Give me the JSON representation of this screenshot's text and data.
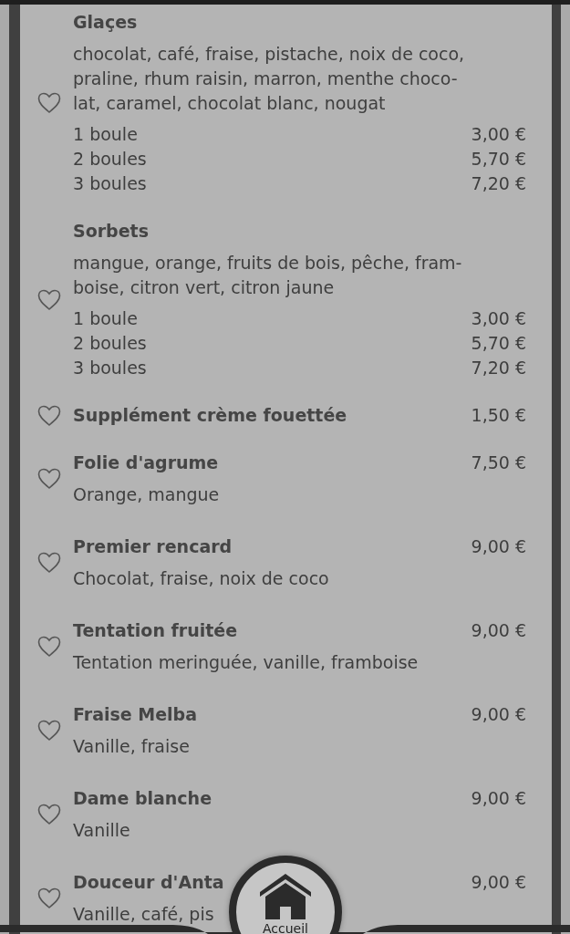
{
  "menu": [
    {
      "kind": "group",
      "name": "Glaçes",
      "description": [
        "chocolat, café, fraise, pistache, noix de coco,",
        "praline, rhum raisin, marron, menthe choco-",
        "lat, caramel, chocolat blanc, nougat"
      ],
      "prices": [
        {
          "label": "1 boule",
          "price": "3,00 €"
        },
        {
          "label": "2 boules",
          "price": "5,70 €"
        },
        {
          "label": "3 boules",
          "price": "7,20 €"
        }
      ]
    },
    {
      "kind": "group",
      "name": "Sorbets",
      "description": [
        "mangue, orange, fruits de bois, pêche, fram-",
        "boise, citron vert, citron jaune"
      ],
      "prices": [
        {
          "label": "1 boule",
          "price": "3,00 €"
        },
        {
          "label": "2 boules",
          "price": "5,70 €"
        },
        {
          "label": "3 boules",
          "price": "7,20 €"
        }
      ]
    },
    {
      "kind": "simple",
      "name": "Supplément crème fouettée",
      "price": "1,50 €"
    },
    {
      "kind": "item",
      "name": "Folie d'agrume",
      "price": "7,50 €",
      "description": "Orange, mangue"
    },
    {
      "kind": "item",
      "name": "Premier rencard",
      "price": "9,00 €",
      "description": "Chocolat, fraise, noix de coco"
    },
    {
      "kind": "item",
      "name": "Tentation fruitée",
      "price": "9,00 €",
      "description": "Tentation meringuée, vanille, framboise"
    },
    {
      "kind": "item",
      "name": "Fraise Melba",
      "price": "9,00 €",
      "description": "Vanille, fraise"
    },
    {
      "kind": "item",
      "name": "Dame blanche",
      "price": "9,00 €",
      "description": "Vanille"
    },
    {
      "kind": "item",
      "name": "Douceur d'Anta",
      "price": "9,00 €",
      "description": "Vanille, café, pis"
    }
  ],
  "home_button": {
    "label": "Accueil"
  }
}
